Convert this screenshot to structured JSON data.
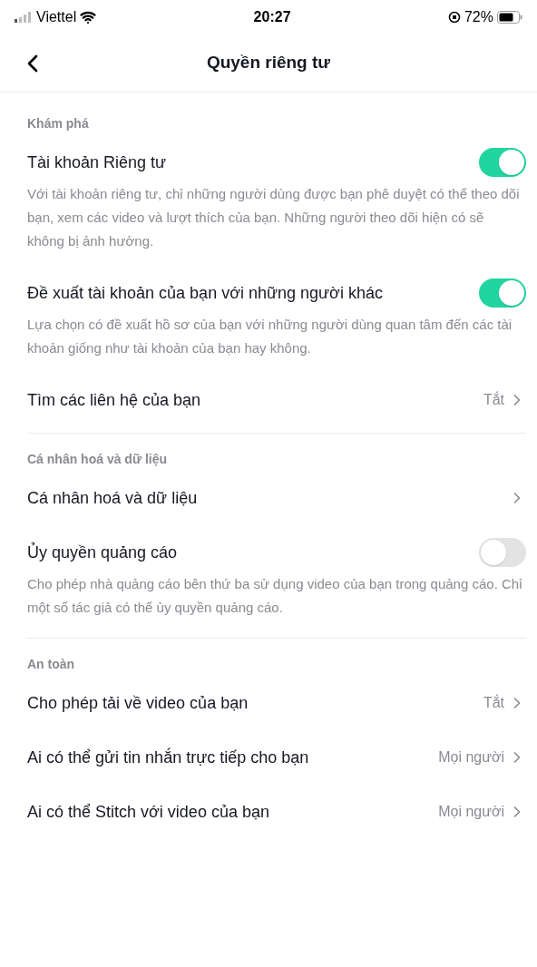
{
  "status_bar": {
    "carrier": "Viettel",
    "time": "20:27",
    "battery": "72%"
  },
  "header": {
    "title": "Quyền riêng tư"
  },
  "sections": [
    {
      "title": "Khám phá",
      "items": [
        {
          "kind": "toggle",
          "label": "Tài khoản Riêng tư",
          "on": true,
          "description": "Với tài khoản riêng tư, chỉ những người dùng được bạn phê duyệt có thể theo dõi bạn, xem các video và lượt thích của bạn. Những người theo dõi hiện có sẽ không bị ảnh hưởng."
        },
        {
          "kind": "toggle",
          "label": "Đề xuất tài khoản của bạn với những người khác",
          "on": true,
          "description": "Lựa chọn có đề xuất hồ sơ của bạn với những người dùng quan tâm đến các tài khoản giống như tài khoản của bạn hay không."
        },
        {
          "kind": "link",
          "label": "Tìm các liên hệ của bạn",
          "value": "Tắt"
        }
      ]
    },
    {
      "title": "Cá nhân hoá và dữ liệu",
      "items": [
        {
          "kind": "link",
          "label": "Cá nhân hoá và dữ liệu"
        },
        {
          "kind": "toggle",
          "label": "Ủy quyền quảng cáo",
          "on": false,
          "description": "Cho phép nhà quảng cáo bên thứ ba sử dụng video của bạn trong quảng cáo. Chỉ một số tác giả có thể ủy quyền quảng cáo."
        }
      ]
    },
    {
      "title": "An toàn",
      "items": [
        {
          "kind": "link",
          "label": "Cho phép tải về video của bạn",
          "value": "Tắt"
        },
        {
          "kind": "link",
          "label": "Ai có thể gửi tin nhắn trực tiếp cho bạn",
          "value": "Mọi người"
        },
        {
          "kind": "link",
          "label": "Ai có thể Stitch với video của bạn",
          "value": "Mọi người"
        }
      ]
    }
  ]
}
